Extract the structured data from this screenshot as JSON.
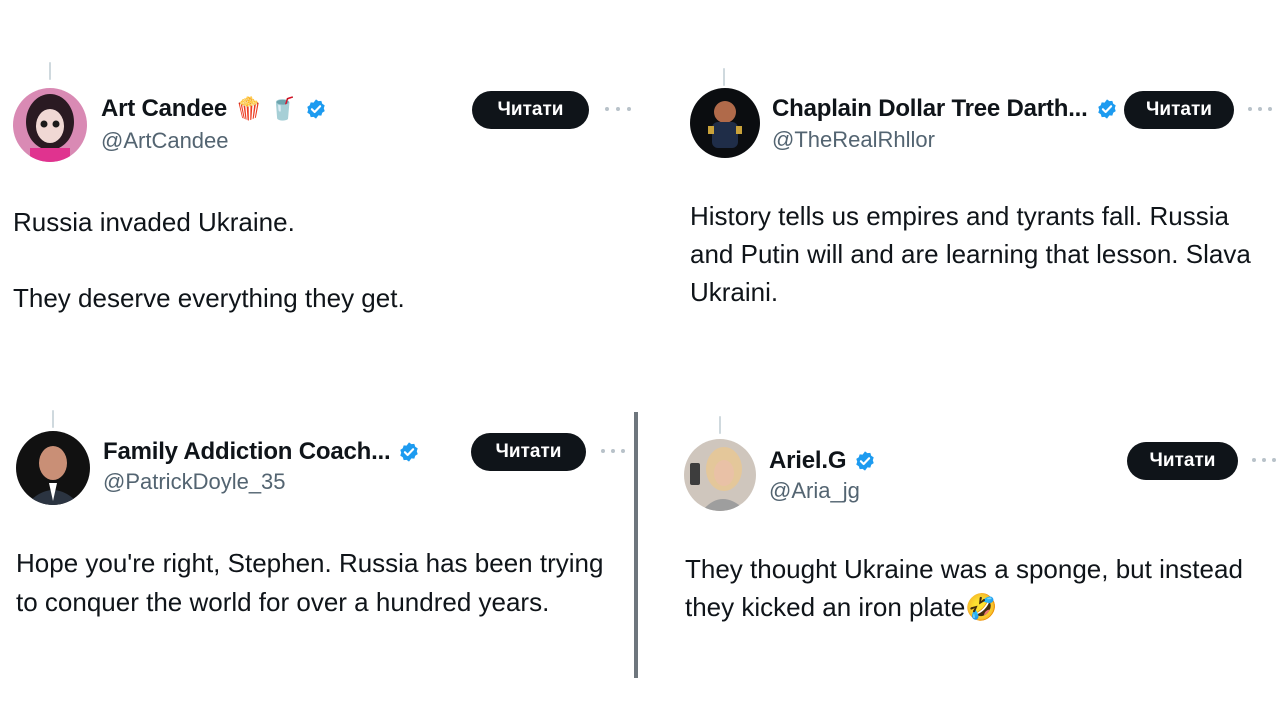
{
  "read_label": "Читати",
  "tweets": [
    {
      "name": "Art Candee",
      "emoji": "🍿 🥤",
      "handle": "@ArtCandee",
      "text_lines": [
        "Russia invaded Ukraine.",
        "They deserve everything they get."
      ]
    },
    {
      "name": "Chaplain Dollar Tree Darth...",
      "handle": "@TheRealRhllor",
      "text": "History tells us empires and tyrants fall. Russia and Putin will and are learning that lesson. Slava Ukraini."
    },
    {
      "name": "Family Addiction Coach...",
      "handle": "@PatrickDoyle_35",
      "text": "Hope you're right, Stephen. Russia has been trying to conquer the world for over a hundred years."
    },
    {
      "name": "Ariel.G",
      "handle": "@Aria_jg",
      "text": "They thought Ukraine was a sponge, but instead they kicked an iron plate🤣"
    }
  ],
  "colors": {
    "verified": "#1d9bf0",
    "button_bg": "#0f1419",
    "handle": "#536471"
  }
}
